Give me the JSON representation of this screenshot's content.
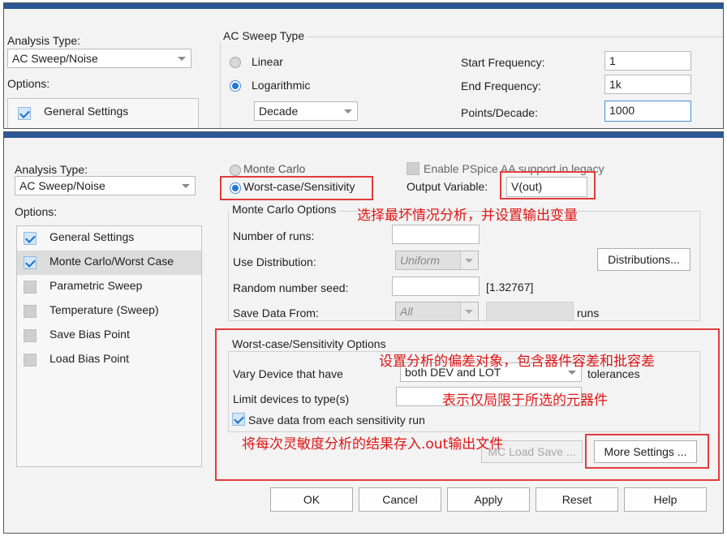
{
  "top": {
    "analysis_type_label": "Analysis Type:",
    "analysis_type_value": "AC Sweep/Noise",
    "options_label": "Options:",
    "general_settings": "General Settings",
    "sweep_group_title": "AC Sweep Type",
    "linear": "Linear",
    "logarithmic": "Logarithmic",
    "decade": "Decade",
    "start_freq_label": "Start Frequency:",
    "start_freq_value": "1",
    "end_freq_label": "End Frequency:",
    "end_freq_value": "1k",
    "points_label": "Points/Decade:",
    "points_value": "1000"
  },
  "bottom": {
    "analysis_type_label": "Analysis Type:",
    "analysis_type_value": "AC Sweep/Noise",
    "options_label": "Options:",
    "options": [
      {
        "label": "General Settings",
        "checked": true
      },
      {
        "label": "Monte Carlo/Worst Case",
        "checked": true
      },
      {
        "label": "Parametric Sweep",
        "checked": false
      },
      {
        "label": "Temperature (Sweep)",
        "checked": false
      },
      {
        "label": "Save Bias Point",
        "checked": false
      },
      {
        "label": "Load Bias Point",
        "checked": false
      }
    ],
    "monte_carlo": "Monte Carlo",
    "worst_case": "Worst-case/Sensitivity",
    "enable_pspice_aa": "Enable PSpice AA support in legacy",
    "output_variable_label": "Output Variable:",
    "output_variable_value": "V(out)",
    "mc_group_title": "Monte Carlo Options",
    "number_of_runs": "Number of runs:",
    "use_distribution": "Use Distribution:",
    "distribution_value": "Uniform",
    "distributions_button": "Distributions...",
    "random_seed": "Random number seed:",
    "random_seed_hint": "[1.32767]",
    "save_data_from": "Save Data From:",
    "save_data_value": "All",
    "runs": "runs",
    "wc_group_title": "Worst-case/Sensitivity Options",
    "vary_device": "Vary Device that have",
    "vary_value": "both DEV and LOT",
    "tolerances": "tolerances",
    "limit_devices": "Limit devices to type(s)",
    "save_each_run": "Save data from each sensitivity run",
    "mc_load_save": "MC Load Save ...",
    "more_settings": "More Settings ...",
    "ok": "OK",
    "cancel": "Cancel",
    "apply": "Apply",
    "reset": "Reset",
    "help": "Help"
  },
  "annotations": {
    "note1": "选择最坏情况分析，并设置输出变量",
    "note2": "设置分析的偏差对象，包含器件容差和批容差",
    "note3": "表示仅局限于所选的元器件",
    "note4": "将每次灵敏度分析的结果存入.out输出文件"
  },
  "colors": {
    "annotation_red": "#e23b3b",
    "accent_blue": "#1e79d8",
    "title_bar": "#2b5797"
  }
}
